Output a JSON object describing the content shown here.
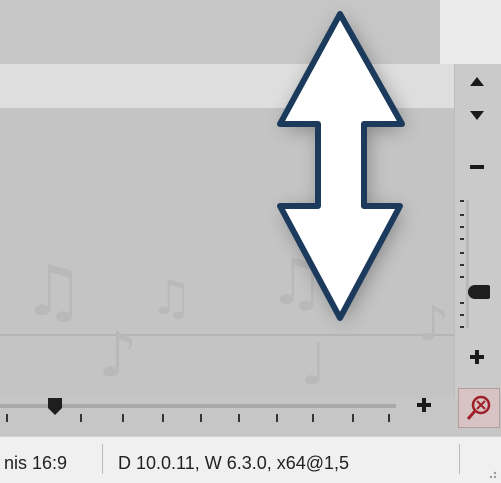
{
  "statusbar": {
    "aspect_text": "nis 16:9",
    "version_text": "D 10.0.11, W 6.3.0, x64@1,5"
  },
  "icons": {
    "scroll_up": "triangle-up-icon",
    "scroll_down": "triangle-down-icon",
    "zoom_out_vertical": "minus-icon",
    "zoom_in_vertical": "plus-icon",
    "zoom_in_horizontal": "plus-icon",
    "zoom_fit": "zoom-fit-icon",
    "resize_arrow": "double-arrow-vertical-icon",
    "resize_grip": "resize-grip-icon"
  },
  "colors": {
    "arrow_fill": "#ffffff",
    "arrow_stroke": "#1b3a5c",
    "zoom_button_bg": "#d7c3c3",
    "zoom_icon": "#a0202a"
  }
}
